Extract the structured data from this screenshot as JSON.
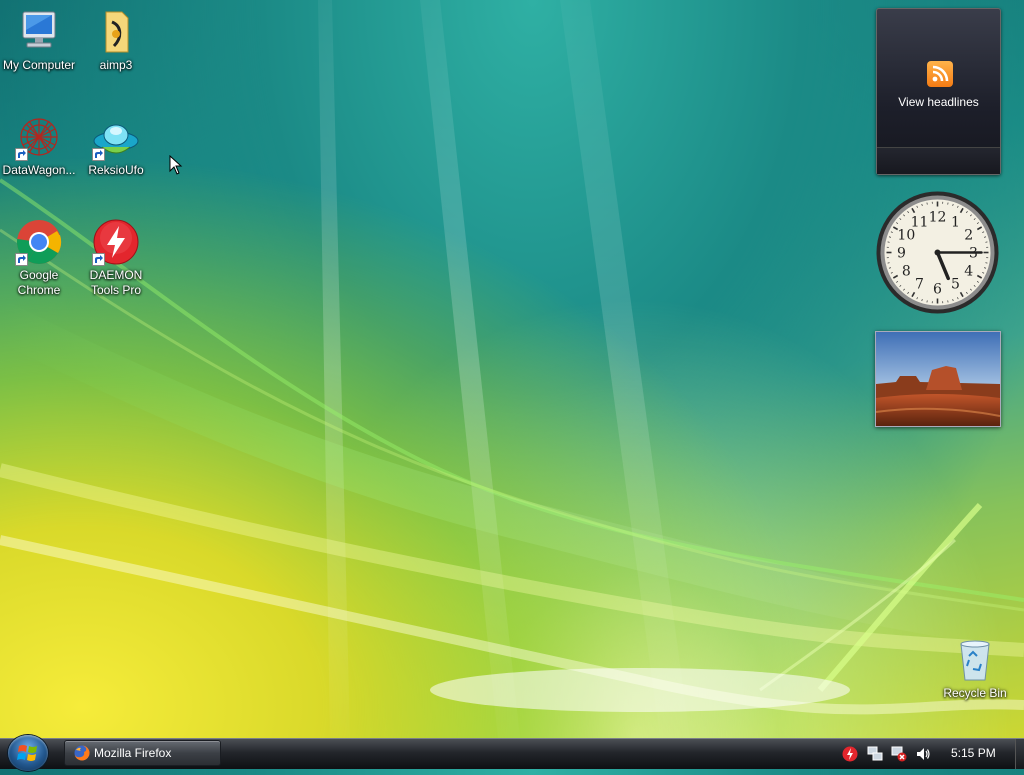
{
  "desktop": {
    "icons": [
      {
        "label": "My Computer"
      },
      {
        "label": "aimp3"
      },
      {
        "label": "DataWagon..."
      },
      {
        "label": "ReksioUfo"
      },
      {
        "label": "Google\nChrome"
      },
      {
        "label": "DAEMON\nTools Pro"
      },
      {
        "label": "Recycle Bin"
      }
    ]
  },
  "gadgets": {
    "feeds": {
      "headline": "View headlines",
      "icon": "rss-icon"
    },
    "clock": {
      "hours": 5,
      "minutes": 15,
      "numerals": [
        "12",
        "1",
        "2",
        "3",
        "4",
        "5",
        "6",
        "7",
        "8",
        "9",
        "10",
        "11"
      ]
    },
    "slideshow": {
      "image": "desert-mesa-photo"
    }
  },
  "taskbar": {
    "start_icon": "windows-logo-icon",
    "buttons": [
      {
        "label": "Mozilla Firefox",
        "icon": "firefox-icon"
      }
    ],
    "tray": {
      "icons": [
        "daemon-tools-icon",
        "network-icon",
        "network-error-icon",
        "volume-icon"
      ],
      "clock": "5:15 PM"
    }
  },
  "colors": {
    "taskbar": "#23262b",
    "rss": "#f47b14",
    "chrome_red": "#db4437",
    "chrome_green": "#0f9d58",
    "chrome_yellow": "#f4b400",
    "chrome_blue": "#4285f4",
    "daemon_red": "#e3262d"
  }
}
